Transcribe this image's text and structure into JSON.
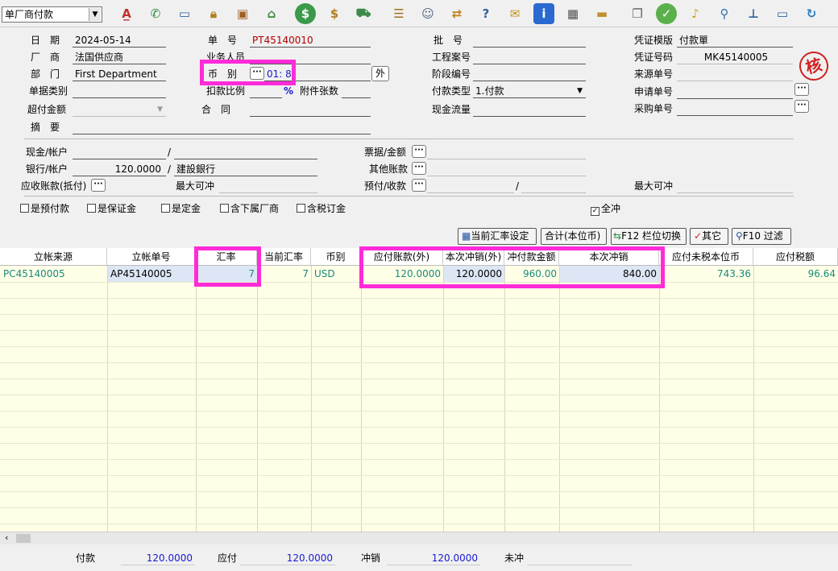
{
  "toolbar": {
    "module_select": "单厂商付款",
    "icons": [
      "spell-check-icon",
      "phone-icon",
      "monitor-icon",
      "lock-icon",
      "briefcase-icon",
      "home-icon",
      "dollar-icon",
      "money-bag-icon",
      "cart-icon",
      "clipboard-icon",
      "users-icon",
      "exchange-icon",
      "help-doc-icon",
      "mail-icon",
      "info-icon",
      "calculator-icon",
      "folder-icon",
      "document-copy-icon",
      "check-icon",
      "bell-icon",
      "search-icon",
      "org-chart-icon",
      "computer-icon",
      "refresh-icon"
    ]
  },
  "header": {
    "date_label": "日　期",
    "date_value": "2024-05-14",
    "vendor_label": "厂　商",
    "vendor_value": "法国供应商",
    "dept_label": "部　门",
    "dept_value": "First Department",
    "doc_type_label": "单据类别",
    "overpay_label": "超付金额",
    "summary_label": "摘　要",
    "doc_no_label": "单　号",
    "doc_no_value": "PT45140010",
    "salesperson_label": "业务人员",
    "currency_label": "币　别",
    "currency_value": "01: 8",
    "foreign_btn": "外",
    "discount_label": "扣款比例",
    "percent": "%",
    "attach_label": "附件张数",
    "contract_label": "合　同",
    "batch_label": "批　号",
    "project_label": "工程案号",
    "stage_label": "阶段编号",
    "pay_type_label": "付款类型",
    "pay_type_value": "1.付款",
    "cashflow_label": "现金流量",
    "voucher_tpl_label": "凭证模版",
    "voucher_tpl_value": "付款單",
    "voucher_no_label": "凭证号码",
    "voucher_no_value": "MK45140005",
    "source_no_label": "来源单号",
    "apply_no_label": "申请单号",
    "purchase_no_label": "采购单号",
    "stamp": "核"
  },
  "payment": {
    "cash_label": "现金/帐户",
    "bank_label": "银行/帐户",
    "bank_amount": "120.0000",
    "bank_name": "建設銀行",
    "recv_label": "应收账款(抵付)",
    "max_offset_label": "最大可冲",
    "bill_label": "票据/金额",
    "other_label": "其他账款",
    "prepay_label": "预付/收款",
    "max_offset_label2": "最大可冲",
    "slash": "/"
  },
  "checks": [
    {
      "label": "是预付款",
      "checked": false
    },
    {
      "label": "是保证金",
      "checked": false
    },
    {
      "label": "是定金",
      "checked": false
    },
    {
      "label": "含下属厂商",
      "checked": false
    },
    {
      "label": "含税订金",
      "checked": false
    },
    {
      "label": "全冲",
      "checked": true
    }
  ],
  "buttons": {
    "rate_setting": "当前汇率设定",
    "total_local": "合计(本位币)",
    "f12": "F12 栏位切换",
    "other": "其它",
    "f10": "F10 过滤"
  },
  "grid": {
    "columns": [
      "立帐来源",
      "立帐单号",
      "汇率",
      "当前汇率",
      "币别",
      "应付账款(外)",
      "本次冲销(外)",
      "冲付款金额",
      "本次冲销",
      "应付未税本位币",
      "应付税额"
    ],
    "rows": [
      [
        "PC45140005",
        "AP45140005",
        "7",
        "7",
        "USD",
        "120.0000",
        "120.0000",
        "960.00",
        "840.00",
        "743.36",
        "96.64"
      ]
    ]
  },
  "footer": {
    "paid_label": "付款",
    "paid_value": "120.0000",
    "payable_label": "应付",
    "payable_value": "120.0000",
    "offset_label": "冲销",
    "offset_value": "120.0000",
    "unoffset_label": "未冲"
  }
}
